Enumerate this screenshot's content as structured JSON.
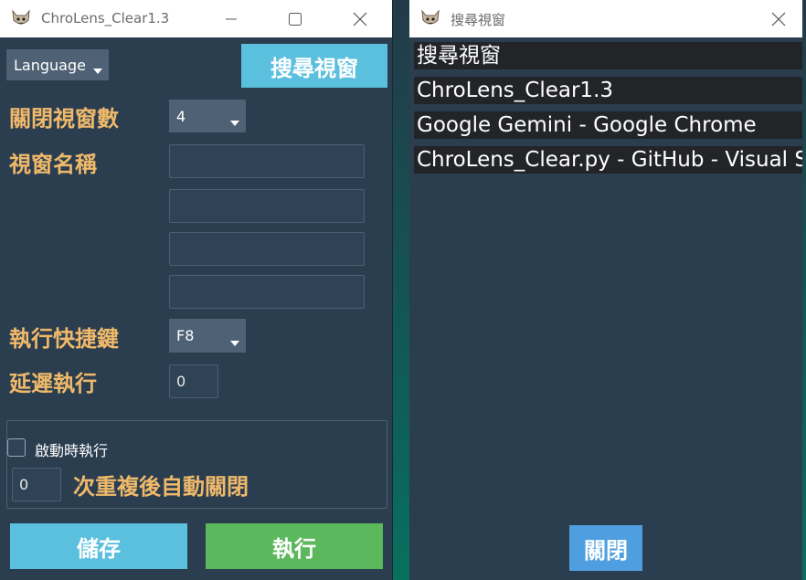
{
  "main_window": {
    "title": "ChroLens_Clear1.3",
    "language_combo": "Language",
    "search_button": "搜尋視窗",
    "close_count_label": "關閉視窗數",
    "close_count_value": "4",
    "window_names_label": "視窗名稱",
    "hotkey_label": "執行快捷鍵",
    "hotkey_value": "F8",
    "delay_label": "延遲執行",
    "delay_value": "0",
    "run_on_start_label": "啟動時執行",
    "repeat_value": "0",
    "repeat_label": "次重複後自動關閉",
    "save_button": "儲存",
    "run_button": "執行"
  },
  "search_window": {
    "title": "搜尋視窗",
    "items": [
      "搜尋視窗",
      "ChroLens_Clear1.3",
      "Google Gemini - Google Chrome",
      "ChroLens_Clear.py - GitHub - Visual Studio Code"
    ],
    "close_button": "關閉"
  },
  "colors": {
    "window_bg": "#2b3e50",
    "label_orange": "#f0b96a",
    "button_blue": "#5bc0de",
    "button_green": "#5cb85c",
    "close_blue": "#4f9fe0"
  }
}
